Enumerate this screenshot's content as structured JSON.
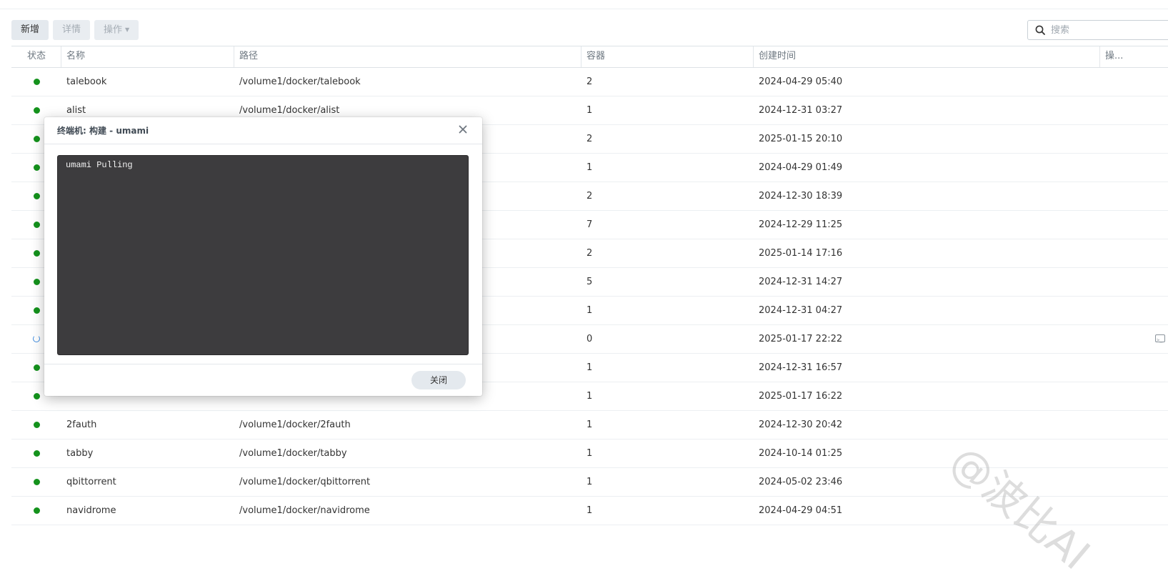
{
  "toolbar": {
    "add_label": "新增",
    "details_label": "详情",
    "actions_label": "操作"
  },
  "search": {
    "placeholder": "搜索"
  },
  "table": {
    "columns": {
      "status": "状态",
      "name": "名称",
      "path": "路径",
      "containers": "容器",
      "created": "创建时间",
      "actions": "操..."
    },
    "rows": [
      {
        "status": "running",
        "name": "talebook",
        "path": "/volume1/docker/talebook",
        "containers": "2",
        "created": "2024-04-29 05:40"
      },
      {
        "status": "running",
        "name": "alist",
        "path": "/volume1/docker/alist",
        "containers": "1",
        "created": "2024-12-31 03:27"
      },
      {
        "status": "running",
        "name": "",
        "path": "",
        "containers": "2",
        "created": "2025-01-15 20:10"
      },
      {
        "status": "running",
        "name": "",
        "path": "",
        "containers": "1",
        "created": "2024-04-29 01:49"
      },
      {
        "status": "running",
        "name": "",
        "path": "",
        "containers": "2",
        "created": "2024-12-30 18:39"
      },
      {
        "status": "running",
        "name": "",
        "path": "",
        "containers": "7",
        "created": "2024-12-29 11:25"
      },
      {
        "status": "running",
        "name": "",
        "path": "",
        "containers": "2",
        "created": "2025-01-14 17:16"
      },
      {
        "status": "running",
        "name": "",
        "path": "",
        "containers": "5",
        "created": "2024-12-31 14:27"
      },
      {
        "status": "running",
        "name": "",
        "path": "",
        "containers": "1",
        "created": "2024-12-31 04:27"
      },
      {
        "status": "building",
        "name": "",
        "path": "",
        "containers": "0",
        "created": "2025-01-17 22:22"
      },
      {
        "status": "running",
        "name": "",
        "path": "",
        "containers": "1",
        "created": "2024-12-31 16:57"
      },
      {
        "status": "running",
        "name": "",
        "path": "",
        "containers": "1",
        "created": "2025-01-17 16:22"
      },
      {
        "status": "running",
        "name": "2fauth",
        "path": "/volume1/docker/2fauth",
        "containers": "1",
        "created": "2024-12-30 20:42"
      },
      {
        "status": "running",
        "name": "tabby",
        "path": "/volume1/docker/tabby",
        "containers": "1",
        "created": "2024-10-14 01:25"
      },
      {
        "status": "running",
        "name": "qbittorrent",
        "path": "/volume1/docker/qbittorrent",
        "containers": "1",
        "created": "2024-05-02 23:46"
      },
      {
        "status": "running",
        "name": "navidrome",
        "path": "/volume1/docker/navidrome",
        "containers": "1",
        "created": "2024-04-29 04:51"
      }
    ]
  },
  "dialog": {
    "title": "终端机: 构建 - umami",
    "terminal_output": "umami Pulling",
    "close_label": "关闭"
  },
  "watermark": "@波比AI",
  "colors": {
    "status_running": "#14921c",
    "status_building": "#3d8be0",
    "terminal_bg": "#3d3c3e",
    "button_bg": "#e4e9ee"
  }
}
